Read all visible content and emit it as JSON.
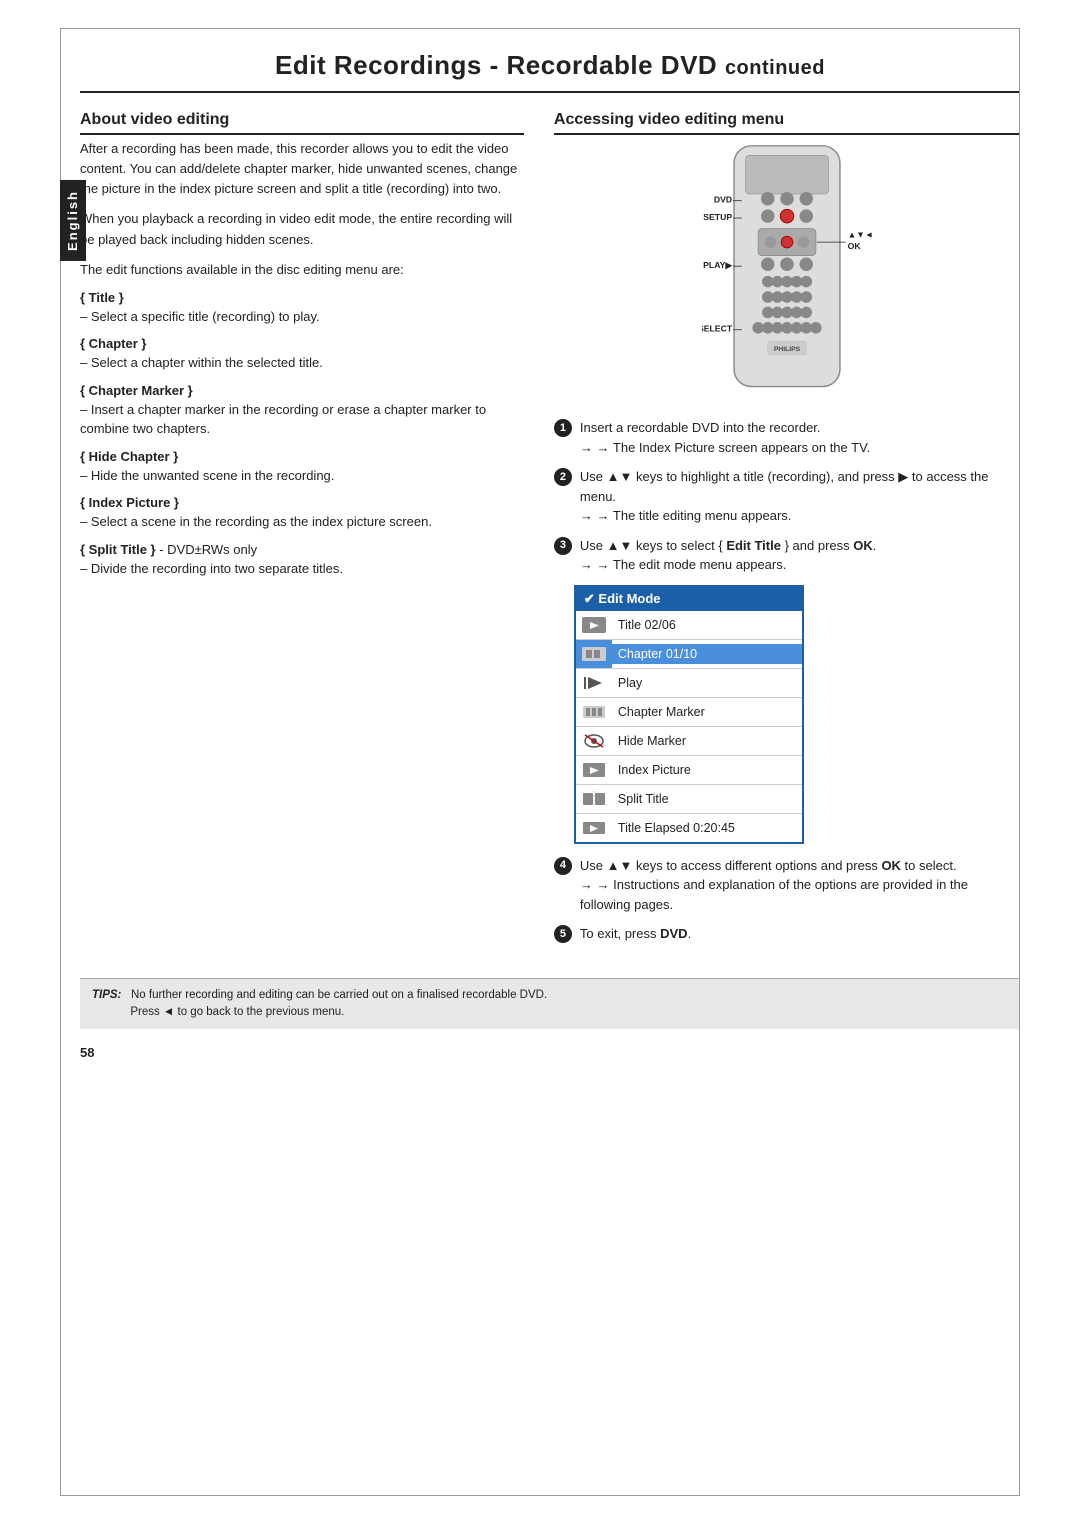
{
  "page": {
    "title": "Edit Recordings - Recordable DVD",
    "title_suffix": "continued",
    "page_number": "58",
    "english_tab": "English"
  },
  "left_section": {
    "heading": "About video editing",
    "intro_paragraphs": [
      "After a recording has been made, this recorder allows you to edit the video content. You can add/delete chapter marker, hide unwanted scenes, change the picture in the index picture screen and split a title (recording) into two.",
      "When you playback a recording in video edit mode, the entire recording will be played back including hidden scenes.",
      "The edit functions available in the disc editing menu are:"
    ],
    "items": [
      {
        "label": "Title",
        "desc": "– Select a specific title (recording) to play."
      },
      {
        "label": "Chapter",
        "desc": "– Select a chapter within the selected title."
      },
      {
        "label": "Chapter Marker",
        "desc": "– Insert a chapter marker in the recording or erase a chapter marker to combine two chapters."
      },
      {
        "label": "Hide Chapter",
        "desc": "– Hide the unwanted scene in the recording."
      },
      {
        "label": "Index Picture",
        "desc": "– Select a scene in the recording as the index picture screen."
      },
      {
        "label": "Split Title",
        "suffix": "- DVD±RWs only",
        "desc": "– Divide the recording into two separate titles."
      }
    ]
  },
  "right_section": {
    "heading": "Accessing video editing menu",
    "remote_labels": {
      "dvd": "DVD",
      "setup": "SETUP",
      "play": "PLAY▶",
      "select": "SELECT",
      "ok": "OK",
      "nav": "▲▼◄▶"
    },
    "steps": [
      {
        "num": "1",
        "text": "Insert a recordable DVD into the recorder.",
        "sub": "→ The Index Picture screen appears on the TV."
      },
      {
        "num": "2",
        "text": "Use ▲▼ keys to highlight a title (recording), and press ▶ to access the menu.",
        "sub": "→ The title editing menu appears."
      },
      {
        "num": "3",
        "text": "Use ▲▼ keys to select { Edit Title } and press OK.",
        "sub": "→ The edit mode menu appears."
      },
      {
        "num": "4",
        "text": "Use ▲▼ keys to access different options and press OK to select.",
        "sub": "→ Instructions and explanation of the options are provided in the following pages."
      },
      {
        "num": "5",
        "text": "To exit, press DVD."
      }
    ],
    "edit_mode_menu": {
      "title": "✔ Edit Mode",
      "rows": [
        {
          "label": "Title 02/06",
          "highlighted": false,
          "icon": "title"
        },
        {
          "label": "Chapter 01/10",
          "highlighted": true,
          "icon": "chapter"
        },
        {
          "label": "Play",
          "highlighted": false,
          "icon": "play"
        },
        {
          "label": "Chapter Marker",
          "highlighted": false,
          "icon": "chapter-marker"
        },
        {
          "label": "Hide Marker",
          "highlighted": false,
          "icon": "hide-marker"
        },
        {
          "label": "Index Picture",
          "highlighted": false,
          "icon": "index-picture"
        },
        {
          "label": "Split Title",
          "highlighted": false,
          "icon": "split-title"
        },
        {
          "label": "Title Elapsed 0:20:45",
          "highlighted": false,
          "icon": "elapsed"
        }
      ]
    }
  },
  "tips": {
    "label": "TIPS:",
    "text": "No further recording and editing can be carried out on a finalised recordable DVD.",
    "text2": "Press ◄ to go back to the previous menu."
  }
}
